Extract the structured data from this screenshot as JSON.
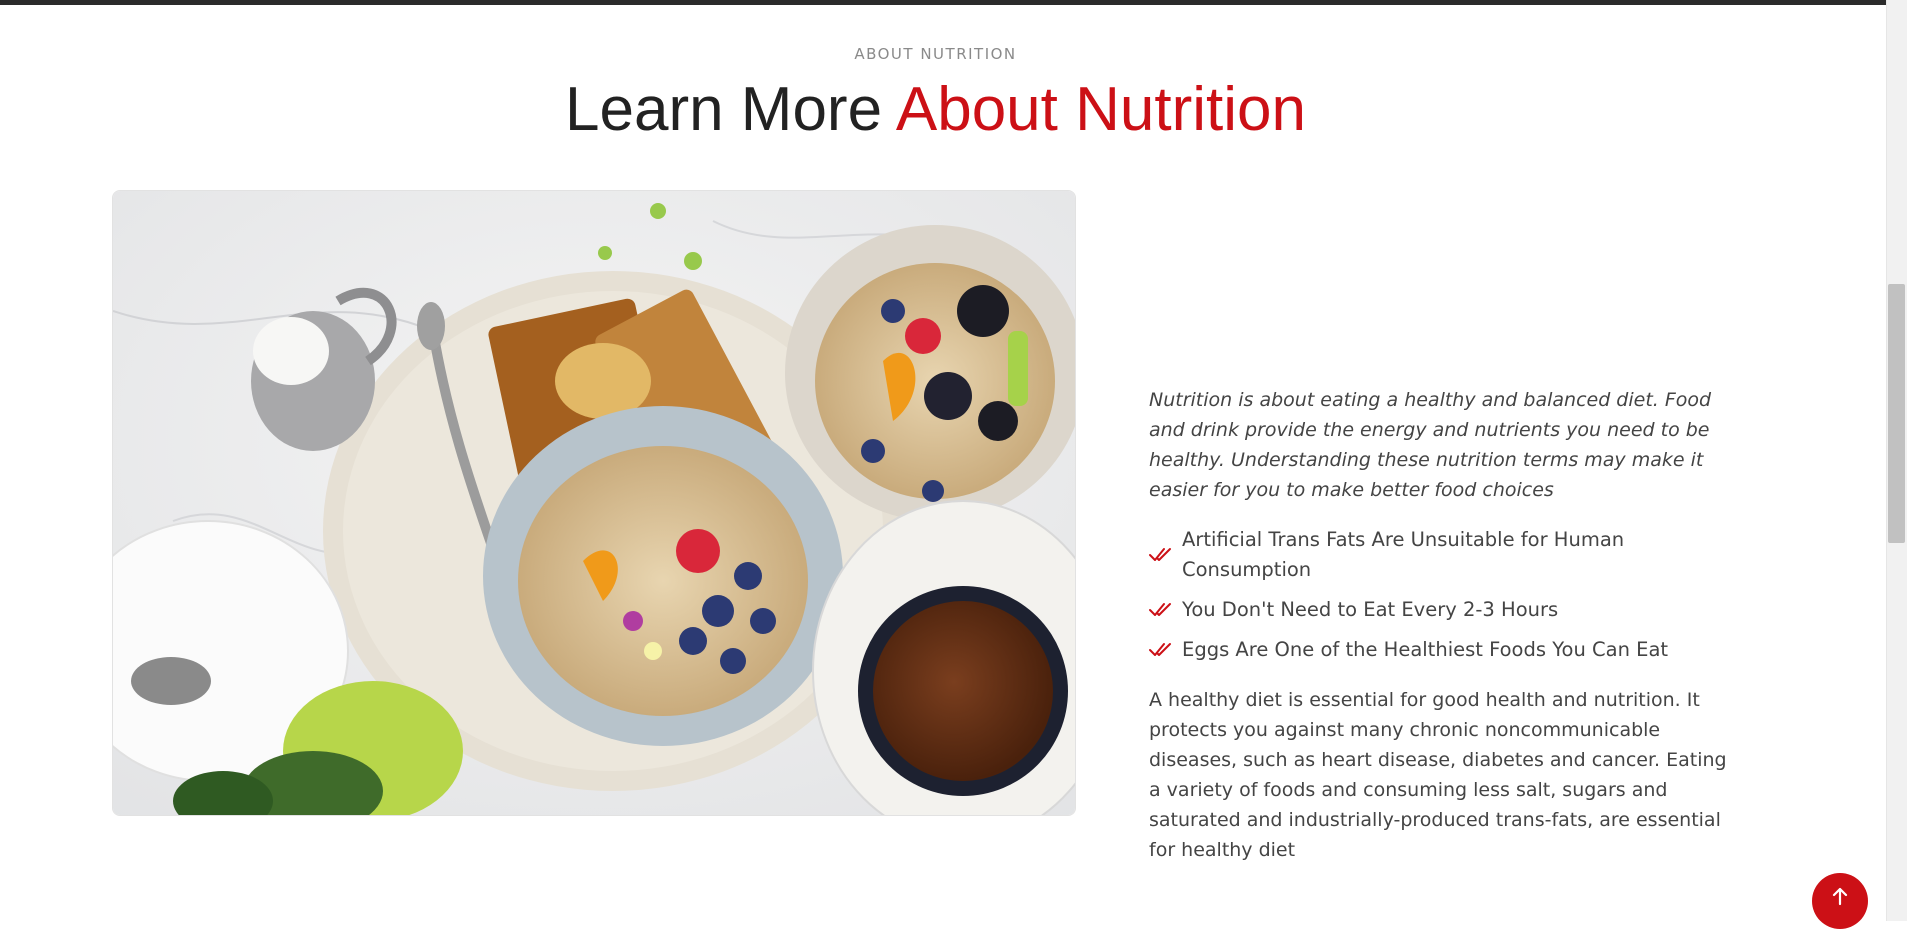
{
  "section": {
    "eyebrow": "About Nutrition",
    "heading_lead": "Learn More ",
    "heading_accent": "About Nutrition"
  },
  "image": {
    "description_name": "healthy-breakfast-photo"
  },
  "content": {
    "intro": "Nutrition is about eating a healthy and balanced diet. Food and drink provide the energy and nutrients you need to be healthy. Understanding these nutrition terms may make it easier for you to make better food choices",
    "checklist": [
      "Artificial Trans Fats Are Unsuitable for Human Consumption",
      "You Don't Need to Eat Every 2-3 Hours",
      "Eggs Are One of the Healthiest Foods You Can Eat"
    ],
    "body": "A healthy diet is essential for good health and nutrition. It protects you against many chronic noncommunicable diseases, such as heart disease, diabetes and cancer. Eating a variety of foods and consuming less salt, sugars and saturated and industrially-produced trans-fats, are essential for healthy diet"
  },
  "icons": {
    "check": "double-check-icon",
    "back_to_top": "arrow-up-icon"
  },
  "colors": {
    "accent": "#cc1016",
    "heading": "#222222",
    "text": "#444444",
    "muted": "#8a8a8a"
  }
}
